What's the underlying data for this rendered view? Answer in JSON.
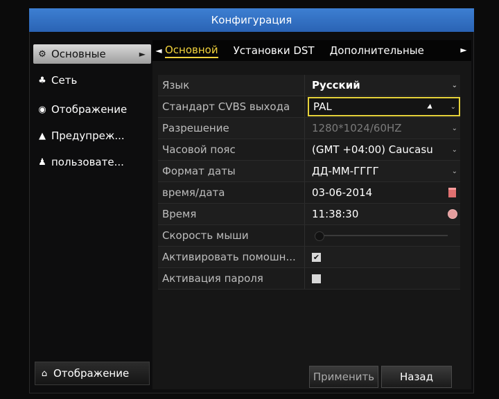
{
  "window": {
    "title": "Конфигурация"
  },
  "sidebar": {
    "items": [
      {
        "label": "Основные",
        "icon": "gear-icon",
        "glyph": "⚙",
        "active": true
      },
      {
        "label": "Сеть",
        "icon": "network-icon",
        "glyph": "♣"
      },
      {
        "label": "Отображение",
        "icon": "eye-icon",
        "glyph": "◉"
      },
      {
        "label": "Предупреж...",
        "icon": "warning-icon",
        "glyph": "▲"
      },
      {
        "label": "пользовате...",
        "icon": "users-icon",
        "glyph": "♟"
      }
    ],
    "bottom_button": {
      "label": "Отображение",
      "icon": "home-icon",
      "glyph": "⌂"
    }
  },
  "tabs": {
    "items": [
      {
        "label": "Основной",
        "active": true
      },
      {
        "label": "Установки DST"
      },
      {
        "label": "Дополнительные"
      }
    ]
  },
  "settings": {
    "rows": [
      {
        "label": "Язык",
        "value": "Русский"
      },
      {
        "label": "Стандарт CVBS выхода",
        "value": "PAL"
      },
      {
        "label": "Разрешение",
        "value": "1280*1024/60HZ"
      },
      {
        "label": "Часовой пояс",
        "value": "(GMT +04:00) Caucasu"
      },
      {
        "label": "Формат даты",
        "value": "ДД-ММ-ГГГГ"
      },
      {
        "label": "время/дата",
        "value": "03-06-2014"
      },
      {
        "label": "Время",
        "value": "11:38:30"
      },
      {
        "label": "Скорость мыши",
        "slider_level": 0.0
      },
      {
        "label": "Активировать помошн...",
        "checked": true
      },
      {
        "label": "Активация пароля",
        "checked": false
      }
    ]
  },
  "buttons": {
    "apply": "Применить",
    "back": "Назад"
  },
  "colors": {
    "title_bar": "#3070c4",
    "active_tab": "#f1d23c",
    "selected_border": "#e6d23a"
  }
}
